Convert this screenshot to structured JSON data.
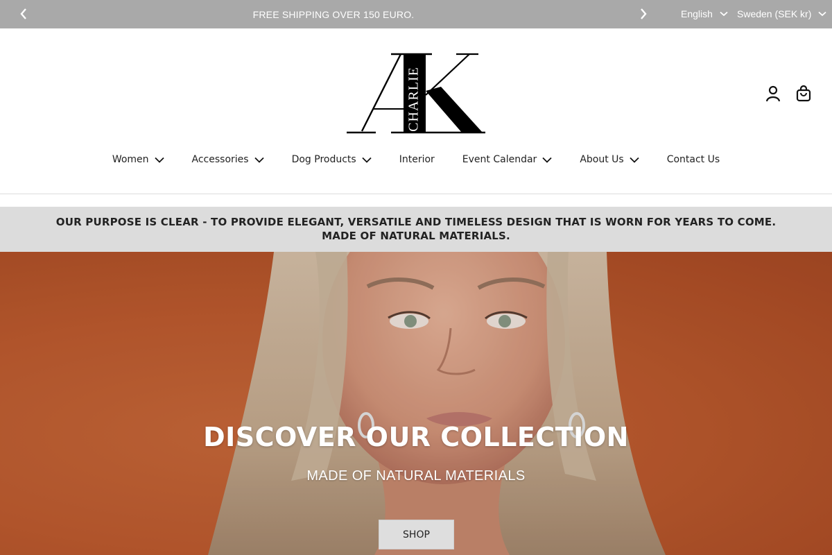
{
  "announcement": {
    "text": "FREE SHIPPING OVER 150 EURO."
  },
  "selectors": {
    "language": "English",
    "country": "Sweden (SEK kr)"
  },
  "logo": {
    "text": "CHARLIE"
  },
  "nav": {
    "items": [
      {
        "label": "Women",
        "has_dropdown": true
      },
      {
        "label": "Accessories",
        "has_dropdown": true
      },
      {
        "label": "Dog Products",
        "has_dropdown": true
      },
      {
        "label": "Interior",
        "has_dropdown": false
      },
      {
        "label": "Event Calendar",
        "has_dropdown": true
      },
      {
        "label": "About Us",
        "has_dropdown": true
      },
      {
        "label": "Contact Us",
        "has_dropdown": false
      }
    ]
  },
  "purpose": {
    "line1": "OUR PURPOSE IS CLEAR - TO PROVIDE ELEGANT, VERSATILE AND TIMELESS DESIGN THAT IS WORN FOR YEARS TO COME.",
    "line2": "MADE OF NATURAL MATERIALS."
  },
  "hero": {
    "title": "DISCOVER OUR COLLECTION",
    "subtitle": "MADE OF NATURAL MATERIALS",
    "button_label": "SHOP"
  },
  "colors": {
    "topbar": "#a9a9a9",
    "purpose_banner": "#dcdcdc",
    "hero_background": "#c0602f"
  },
  "icons": {
    "prev": "chevron-left-icon",
    "next": "chevron-right-icon",
    "dropdown": "chevron-down-icon",
    "account": "user-icon",
    "cart": "shopping-bag-icon"
  }
}
